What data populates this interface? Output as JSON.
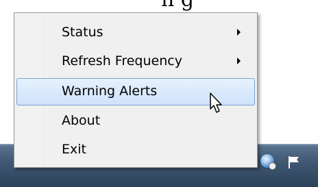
{
  "background_text": "n g",
  "menu": {
    "items": [
      {
        "label": "Status",
        "has_submenu": true
      },
      {
        "label": "Refresh Frequency",
        "has_submenu": true
      },
      {
        "label": "Warning Alerts",
        "has_submenu": false,
        "hovered": true
      },
      {
        "label": "About",
        "has_submenu": false
      },
      {
        "label": "Exit",
        "has_submenu": false
      }
    ]
  },
  "tray": {
    "icons": [
      "globe-network-icon",
      "flag-action-center-icon"
    ]
  },
  "colors": {
    "menu_bg": "#f0f0f0",
    "hover_bg": "#cfe3fb",
    "hover_border": "#7da2ce",
    "taskbar": "#3e5670"
  }
}
